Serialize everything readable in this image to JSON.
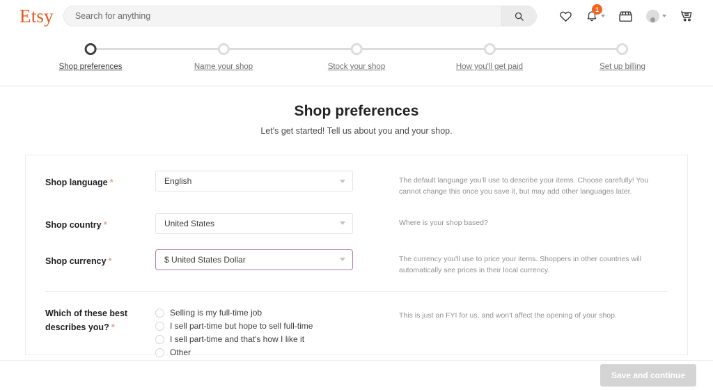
{
  "header": {
    "logo": "Etsy",
    "search": {
      "placeholder": "Search for anything",
      "value": "",
      "icon": "search-icon"
    },
    "icons": {
      "favorites": "heart-icon",
      "notifications": "bell-icon",
      "notifications_badge": "1",
      "shop": "storefront-icon",
      "account": "avatar-icon",
      "cart": "cart-icon"
    }
  },
  "stepper": {
    "steps": [
      {
        "label": "Shop preferences",
        "active": true
      },
      {
        "label": "Name your shop",
        "active": false
      },
      {
        "label": "Stock your shop",
        "active": false
      },
      {
        "label": "How you'll get paid",
        "active": false
      },
      {
        "label": "Set up billing",
        "active": false
      }
    ]
  },
  "main": {
    "title": "Shop preferences",
    "subtitle": "Let's get started! Tell us about you and your shop.",
    "fields": [
      {
        "label": "Shop language",
        "required": "*",
        "value": "English",
        "help": "The default language you'll use to describe your items. Choose carefully! You cannot change this once you save it, but may add other languages later."
      },
      {
        "label": "Shop country",
        "required": "*",
        "value": "United States",
        "help": "Where is your shop based?"
      },
      {
        "label": "Shop currency",
        "required": "*",
        "value": "$ United States Dollar",
        "help": "The currency you'll use to price your items. Shoppers in other countries will automatically see prices in their local currency."
      }
    ],
    "radio_group": {
      "label_line1": "Which of these best",
      "label_line2": "describes you?",
      "required": "*",
      "help": "This is just an FYI for us, and won't affect the opening of your shop.",
      "options": [
        {
          "text": "Selling is my full-time job",
          "selected": false
        },
        {
          "text": "I sell part-time but hope to sell full-time",
          "selected": false
        },
        {
          "text": "I sell part-time and that's how I like it",
          "selected": false
        },
        {
          "text": "Other",
          "selected": false
        }
      ]
    }
  },
  "footer": {
    "save_label": "Save and continue"
  },
  "colors": {
    "brand_orange": "#e8541f",
    "badge_orange": "#f1641e",
    "focus_purple": "#b57bab",
    "required_asterisk": "#e8a48c",
    "disabled_button": "#d4d4d4"
  }
}
